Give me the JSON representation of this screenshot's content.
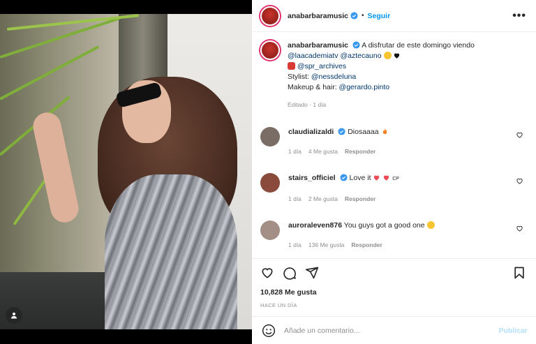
{
  "header": {
    "username": "anabarbaramusic",
    "separator": "•",
    "follow_label": "Seguir",
    "more_label": "•••"
  },
  "caption": {
    "username": "anabarbaramusic",
    "line1_text": "A disfrutar de este domingo viendo",
    "mention1": "@laacademiatv",
    "mention2": "@aztecauno",
    "mention3": "@spr_archives",
    "stylist_label": "Stylist:",
    "mention4": "@nessdeluna",
    "makeup_label": "Makeup & hair:",
    "mention5": "@gerardo.pinto",
    "meta": "Editado · 1 día"
  },
  "comments": [
    {
      "username": "claudializaldi",
      "text": "Diosaaaa",
      "time": "1 día",
      "likes": "4 Me gusta",
      "reply": "Responder",
      "avatar_color": "#7a6d66"
    },
    {
      "username": "stairs_officiel",
      "text": "Love it",
      "suffix": "CP",
      "time": "1 día",
      "likes": "2 Me gusta",
      "reply": "Responder",
      "avatar_color": "#8a4a3c"
    },
    {
      "username": "auroraleven876",
      "text": "You guys got a good one",
      "time": "1 día",
      "likes": "136 Me gusta",
      "reply": "Responder",
      "avatar_color": "#a38f86"
    }
  ],
  "actions": {
    "likes": "10,828 Me gusta",
    "time": "HACE UN DÍA"
  },
  "add_comment": {
    "placeholder": "Añade un comentario...",
    "publish": "Publicar"
  },
  "colors": {
    "accent": "#0095f6",
    "verified": "#3897f0",
    "heart": "#ed4956"
  }
}
